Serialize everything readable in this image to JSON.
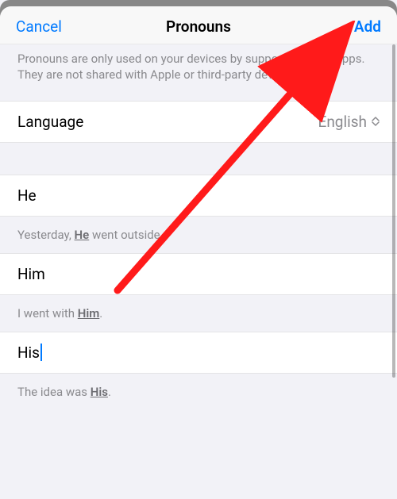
{
  "header": {
    "cancel_label": "Cancel",
    "title": "Pronouns",
    "add_label": "Add"
  },
  "description": "Pronouns are only used on your devices by supported Apple apps. They are not shared with Apple or third-party developers.",
  "language": {
    "label": "Language",
    "value": "English"
  },
  "pronouns": [
    {
      "value": "He",
      "example_pre": "Yesterday, ",
      "example_hl": "He",
      "example_post": " went outside."
    },
    {
      "value": "Him",
      "example_pre": "I went with ",
      "example_hl": "Him",
      "example_post": "."
    },
    {
      "value": "His",
      "example_pre": "The idea was ",
      "example_hl": "His",
      "example_post": "."
    }
  ],
  "active_input_index": 2,
  "annotation": {
    "color": "#ff1a1a"
  }
}
